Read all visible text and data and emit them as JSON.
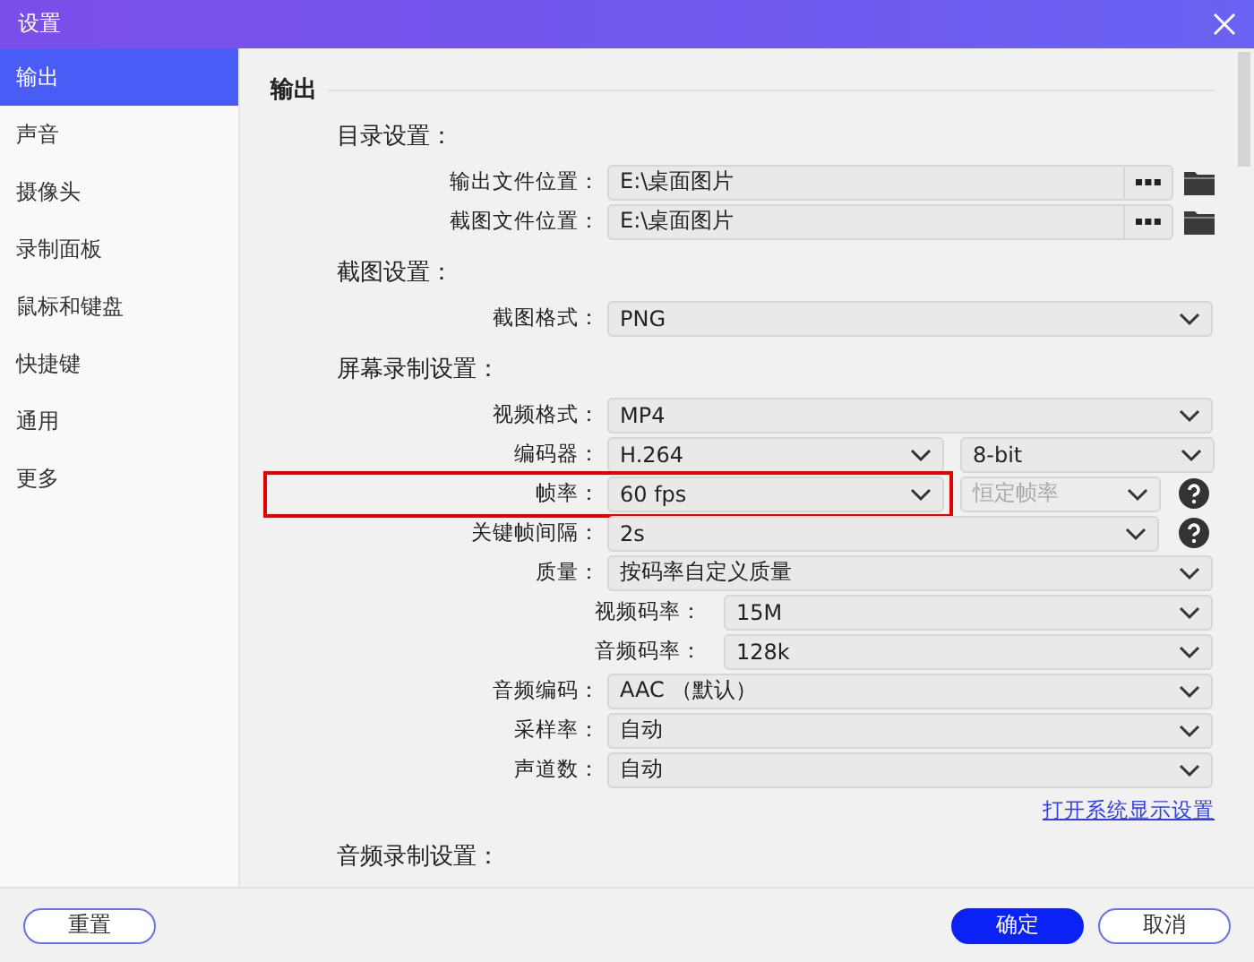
{
  "window": {
    "title": "设置"
  },
  "sidebar": {
    "items": [
      {
        "label": "输出",
        "selected": true
      },
      {
        "label": "声音",
        "selected": false
      },
      {
        "label": "摄像头",
        "selected": false
      },
      {
        "label": "录制面板",
        "selected": false
      },
      {
        "label": "鼠标和键盘",
        "selected": false
      },
      {
        "label": "快捷键",
        "selected": false
      },
      {
        "label": "通用",
        "selected": false
      },
      {
        "label": "更多",
        "selected": false
      }
    ]
  },
  "section_title": "输出",
  "groups": [
    {
      "title": "目录设置：",
      "rows": [
        {
          "kind": "path",
          "label": "输出文件位置：",
          "value": "E:\\桌面图片",
          "highlighted": false
        },
        {
          "kind": "path",
          "label": "截图文件位置：",
          "value": "E:\\桌面图片",
          "highlighted": false
        }
      ]
    },
    {
      "title": "截图设置：",
      "rows": [
        {
          "kind": "select",
          "label": "截图格式：",
          "controls": [
            {
              "value": "PNG",
              "disabled": false
            }
          ],
          "help": false,
          "highlighted": false
        }
      ]
    },
    {
      "title": "屏幕录制设置：",
      "rows": [
        {
          "kind": "select",
          "label": "视频格式：",
          "controls": [
            {
              "value": "MP4",
              "disabled": false
            }
          ],
          "help": false,
          "highlighted": false
        },
        {
          "kind": "select",
          "label": "编码器：",
          "controls": [
            {
              "value": "H.264",
              "disabled": false
            },
            {
              "value": "8-bit",
              "disabled": false
            }
          ],
          "help": false,
          "highlighted": false
        },
        {
          "kind": "select",
          "label": "帧率：",
          "controls": [
            {
              "value": "60 fps",
              "disabled": false
            },
            {
              "value": "恒定帧率",
              "disabled": true
            }
          ],
          "help": true,
          "highlighted": true
        },
        {
          "kind": "select",
          "label": "关键帧间隔：",
          "controls": [
            {
              "value": "2s",
              "disabled": false
            }
          ],
          "help": true,
          "highlighted": false
        },
        {
          "kind": "select",
          "label": "质量：",
          "controls": [
            {
              "value": "按码率自定义质量",
              "disabled": false
            }
          ],
          "help": false,
          "highlighted": false,
          "children": [
            {
              "kind": "select",
              "label": "视频码率：",
              "controls": [
                {
                  "value": "15M",
                  "disabled": false
                }
              ],
              "help": false,
              "highlighted": false
            },
            {
              "kind": "select",
              "label": "音频码率：",
              "controls": [
                {
                  "value": "128k",
                  "disabled": false
                }
              ],
              "help": false,
              "highlighted": false
            }
          ]
        },
        {
          "kind": "select",
          "label": "音频编码：",
          "controls": [
            {
              "value": "AAC （默认）",
              "disabled": false
            }
          ],
          "help": false,
          "highlighted": false
        },
        {
          "kind": "select",
          "label": "采样率：",
          "controls": [
            {
              "value": "自动",
              "disabled": false
            }
          ],
          "help": false,
          "highlighted": false
        },
        {
          "kind": "select",
          "label": "声道数：",
          "controls": [
            {
              "value": "自动",
              "disabled": false
            }
          ],
          "help": false,
          "highlighted": false
        }
      ],
      "link": "打开系统显示设置"
    },
    {
      "title": "音频录制设置："
    }
  ],
  "footer": {
    "buttons": [
      {
        "label": "重置",
        "kind": "outline"
      },
      {
        "label": "确定",
        "kind": "primary"
      },
      {
        "label": "取消",
        "kind": "outline"
      }
    ]
  }
}
